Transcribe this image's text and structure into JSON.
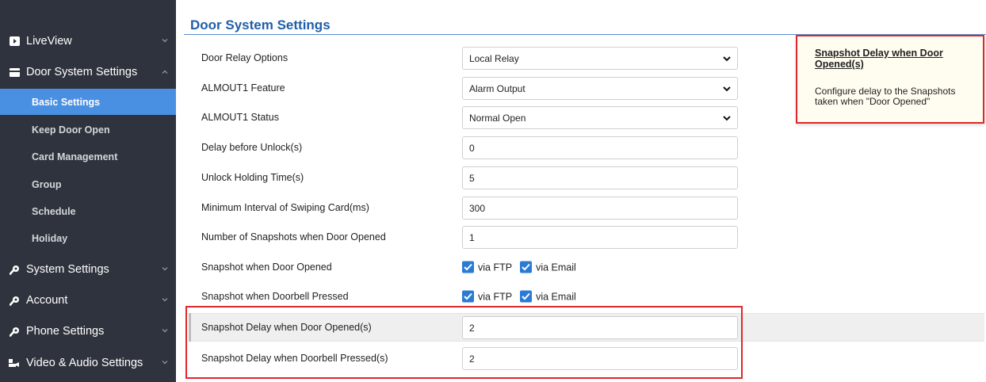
{
  "sidebar": {
    "items": [
      {
        "label": "LiveView",
        "icon": "play-icon"
      },
      {
        "label": "Door System Settings",
        "icon": "card-icon"
      },
      {
        "label": "System Settings",
        "icon": "wrench-icon"
      },
      {
        "label": "Account",
        "icon": "wrench-icon"
      },
      {
        "label": "Phone Settings",
        "icon": "wrench-icon"
      },
      {
        "label": "Video & Audio Settings",
        "icon": "video-audio-icon"
      }
    ],
    "subitems": [
      {
        "label": "Basic Settings",
        "active": true
      },
      {
        "label": "Keep Door Open"
      },
      {
        "label": "Card Management"
      },
      {
        "label": "Group"
      },
      {
        "label": "Schedule"
      },
      {
        "label": "Holiday"
      }
    ]
  },
  "main": {
    "title": "Door System Settings",
    "rows": [
      {
        "label": "Door Relay Options",
        "type": "select",
        "value": "Local Relay"
      },
      {
        "label": "ALMOUT1 Feature",
        "type": "select",
        "value": "Alarm Output"
      },
      {
        "label": "ALMOUT1 Status",
        "type": "select",
        "value": "Normal Open"
      },
      {
        "label": "Delay before Unlock(s)",
        "type": "input",
        "value": "0"
      },
      {
        "label": "Unlock Holding Time(s)",
        "type": "input",
        "value": "5"
      },
      {
        "label": "Minimum Interval of Swiping Card(ms)",
        "type": "input",
        "value": "300"
      },
      {
        "label": "Number of Snapshots when Door Opened",
        "type": "input",
        "value": "1"
      },
      {
        "label": "Snapshot when Door Opened",
        "type": "checkbox",
        "ftp": "via FTP",
        "email": "via Email"
      },
      {
        "label": "Snapshot when Doorbell Pressed",
        "type": "checkbox",
        "ftp": "via FTP",
        "email": "via Email"
      },
      {
        "label": "Snapshot Delay when Door Opened(s)",
        "type": "input",
        "value": "2"
      },
      {
        "label": "Snapshot Delay when Doorbell Pressed(s)",
        "type": "input",
        "value": "2"
      }
    ]
  },
  "tooltip": {
    "title": "Snapshot Delay when Door Opened(s)",
    "body": "Configure delay to the Snapshots taken when \"Door Opened\""
  },
  "colors": {
    "sidebar_bg": "#2f333d",
    "active_item": "#4a90e2",
    "title": "#1f5fa8",
    "checkbox": "#2b7bd4",
    "annotation_red": "#e0262b"
  }
}
